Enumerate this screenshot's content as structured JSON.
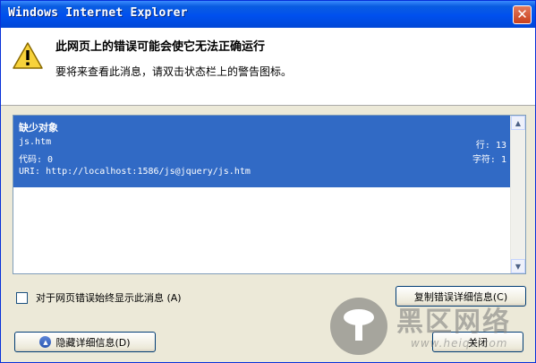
{
  "window": {
    "title": "Windows Internet Explorer",
    "close_glyph": "✕"
  },
  "header": {
    "icon": "warning-icon",
    "heading": "此网页上的错误可能会使它无法正确运行",
    "subtext": "要将来查看此消息，请双击状态栏上的警告图标。"
  },
  "details": {
    "error_title": "缺少对象",
    "file": "js.htm",
    "line_label": "行: 13",
    "code_label": "代码: 0",
    "char_label": "字符: 1",
    "uri_label": "URI: http://localhost:1586/js@jquery/js.htm"
  },
  "checkbox": {
    "label": "对于网页错误始终显示此消息 (A)",
    "checked": false
  },
  "buttons": {
    "copy": "复制错误详细信息(C)",
    "hide": "隐藏详细信息(D)",
    "close": "关闭"
  },
  "watermark": {
    "text": "黑区网络",
    "url": "www.heiqu.com"
  }
}
